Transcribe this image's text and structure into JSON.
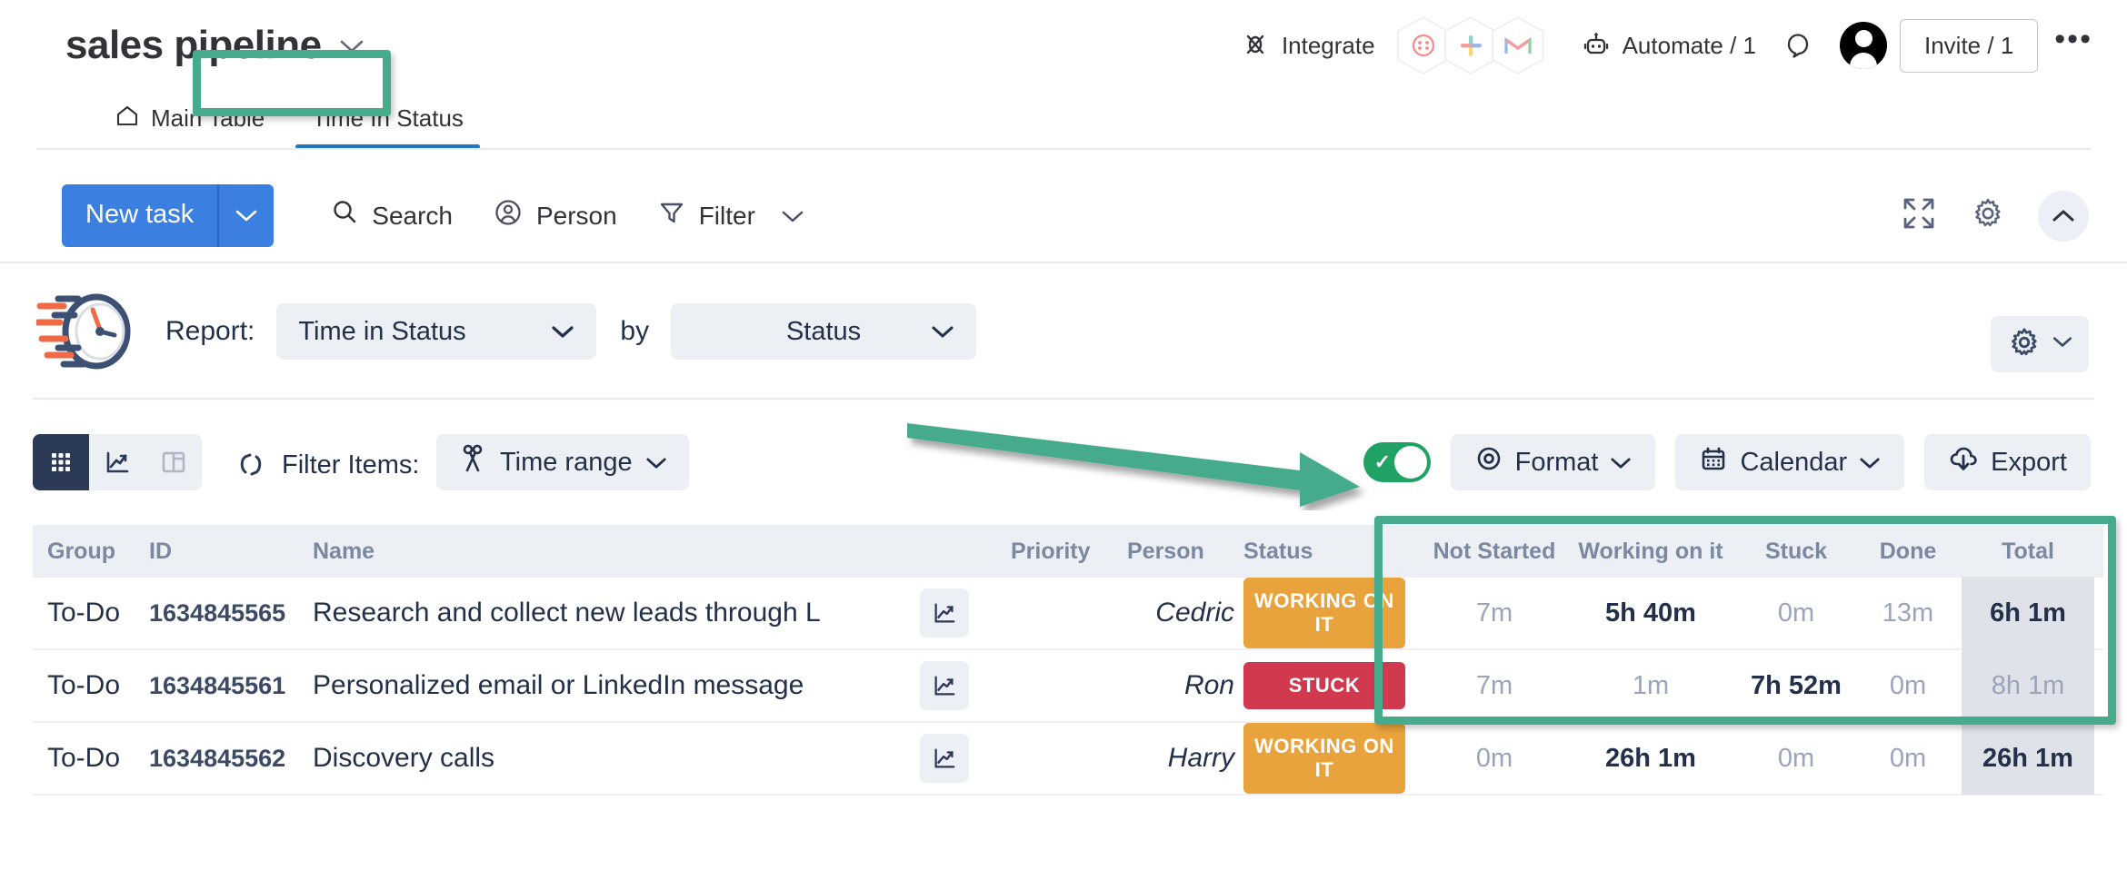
{
  "header": {
    "board_title": "sales pipeline",
    "title_chevron": "chevron-down-icon",
    "integrate_label": "Integrate",
    "integration_badges": [
      "dialpad-icon",
      "slack-icon",
      "gmail-icon"
    ],
    "automate_label": "Automate / 1",
    "chat_icon": "speech-bubble-icon",
    "avatar": "user-avatar",
    "invite_label": "Invite / 1",
    "more_label": "•••"
  },
  "tabs": [
    {
      "label": "Main Table",
      "icon": "home-icon",
      "active": false
    },
    {
      "label": "Time In Status",
      "icon": "",
      "active": true
    }
  ],
  "toolbar": {
    "new_task_label": "New task",
    "new_task_chevron": "chevron-down-icon",
    "items": [
      {
        "label": "Search",
        "icon": "search-icon"
      },
      {
        "label": "Person",
        "icon": "person-circle-icon"
      },
      {
        "label": "Filter",
        "icon": "filter-funnel-icon",
        "chevron": "chevron-down-icon"
      }
    ],
    "right_icons": [
      "expand-arrows-icon",
      "gear-icon",
      "chevron-up-icon"
    ]
  },
  "report_bar": {
    "logo": "stopwatch-speed-logo",
    "report_label": "Report:",
    "report_value": "Time in Status",
    "by_label": "by",
    "group_by_value": "Status",
    "gear_icon": "gear-icon",
    "gear_chevron": "chevron-down-icon"
  },
  "view_bar": {
    "views": [
      {
        "icon": "grid-view-icon",
        "active": true
      },
      {
        "icon": "chart-view-icon",
        "active": false
      },
      {
        "icon": "table-view-icon",
        "active": false
      }
    ],
    "refresh_icon": "refresh-icon",
    "filter_items_label": "Filter Items:",
    "time_range_label": "Time range",
    "time_range_icon": "scissors-icon",
    "time_range_chevron": "chevron-down-icon",
    "toggle_on": true,
    "toggle_check": "✓",
    "buttons": [
      {
        "label": "Format",
        "icon": "target-icon",
        "chevron": "chevron-down-icon"
      },
      {
        "label": "Calendar",
        "icon": "calendar-icon",
        "chevron": "chevron-down-icon"
      },
      {
        "label": "Export",
        "icon": "cloud-download-icon",
        "chevron": ""
      }
    ]
  },
  "table": {
    "headers": {
      "group": "Group",
      "id": "ID",
      "name": "Name",
      "priority": "Priority",
      "person": "Person",
      "status": "Status",
      "not_started": "Not Started",
      "working_on_it": "Working on it",
      "stuck": "Stuck",
      "done": "Done",
      "total": "Total"
    },
    "rows": [
      {
        "group": "To-Do",
        "id": "1634845565",
        "name": "Research and collect new leads through L",
        "priority": "",
        "person": "Cedric",
        "status": "WORKING ON IT",
        "status_color": "#e8a33d",
        "not_started": "7m",
        "working_on_it": "5h 40m",
        "stuck": "0m",
        "done": "13m",
        "total": "6h 1m",
        "bold_col": "working_on_it",
        "total_bold": true
      },
      {
        "group": "To-Do",
        "id": "1634845561",
        "name": "Personalized email or LinkedIn message",
        "priority": "",
        "person": "Ron",
        "status": "STUCK",
        "status_color": "#d0394e",
        "not_started": "7m",
        "working_on_it": "1m",
        "stuck": "7h 52m",
        "done": "0m",
        "total": "8h 1m",
        "bold_col": "stuck",
        "total_bold": false
      },
      {
        "group": "To-Do",
        "id": "1634845562",
        "name": "Discovery calls",
        "priority": "",
        "person": "Harry",
        "status": "WORKING ON IT",
        "status_color": "#e8a33d",
        "not_started": "0m",
        "working_on_it": "26h 1m",
        "stuck": "0m",
        "done": "0m",
        "total": "26h 1m",
        "bold_col": "working_on_it",
        "total_bold": true
      }
    ]
  },
  "annotations": {
    "accent_color": "#45ab8c",
    "tab_highlight_target": "Time In Status",
    "table_highlight_target": "status-time-columns",
    "arrow_target": "view-toggle-switch"
  },
  "colors": {
    "primary_blue": "#3b7fe0",
    "tab_underline": "#1f76c2",
    "toggle_green": "#20a265",
    "status_working": "#e8a33d",
    "status_stuck": "#d0394e",
    "annotation_green": "#45ab8c",
    "navy_text": "#22304a",
    "muted_text": "#9aa4ba"
  }
}
